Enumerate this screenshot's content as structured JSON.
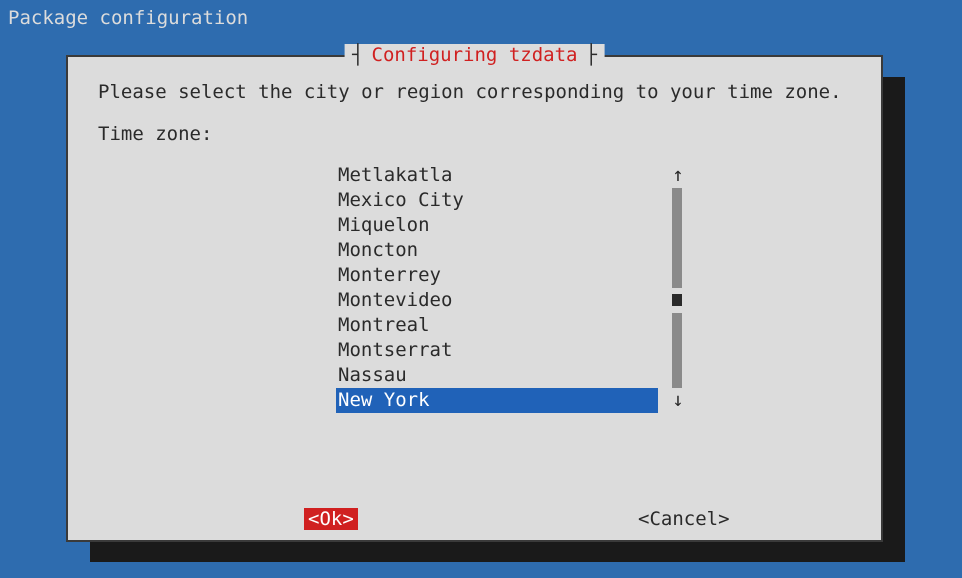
{
  "header": "Package configuration",
  "dialog": {
    "title_decoration_left": "┤",
    "title_decoration_right": "├",
    "title": "Configuring tzdata",
    "prompt": "Please select the city or region corresponding to your time zone.",
    "label": "Time zone:",
    "items": [
      "Metlakatla",
      "Mexico City",
      "Miquelon",
      "Moncton",
      "Monterrey",
      "Montevideo",
      "Montreal",
      "Montserrat",
      "Nassau",
      "New York"
    ],
    "selected_index": 9,
    "scroll_up": "↑",
    "scroll_down": "↓",
    "ok": "<Ok>",
    "cancel": "<Cancel>"
  }
}
